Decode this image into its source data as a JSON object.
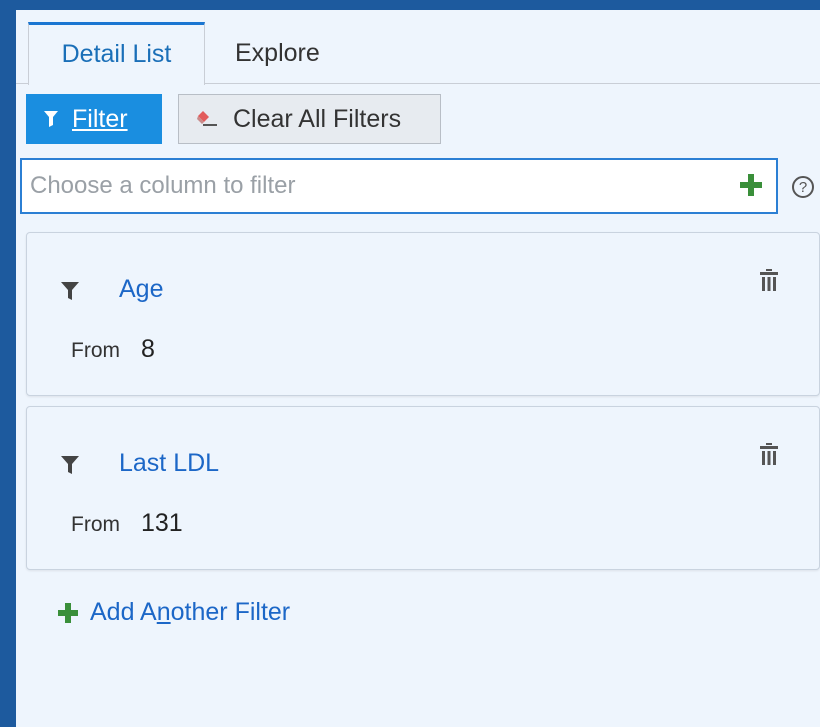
{
  "tabs": [
    {
      "label": "Detail List",
      "active": true
    },
    {
      "label": "Explore",
      "active": false
    }
  ],
  "toolbar": {
    "filter_label": "Filter",
    "clear_label": "Clear All Filters"
  },
  "search": {
    "placeholder": "Choose a column to filter",
    "value": "",
    "help": "?"
  },
  "filters": [
    {
      "name": "Age",
      "from_label": "From",
      "from_value": "8"
    },
    {
      "name": "Last LDL",
      "from_label": "From",
      "from_value": "131"
    }
  ],
  "add_filter": {
    "pre": "Add A",
    "accel": "n",
    "post": "other Filter"
  },
  "colors": {
    "accent": "#1a8ee0",
    "link": "#1c67c7",
    "add_green": "#3a8f3a",
    "background": "#eef5fd"
  },
  "icons": [
    "filter-icon",
    "eraser-icon",
    "plus-icon",
    "help-icon",
    "funnel-icon",
    "trash-icon"
  ]
}
